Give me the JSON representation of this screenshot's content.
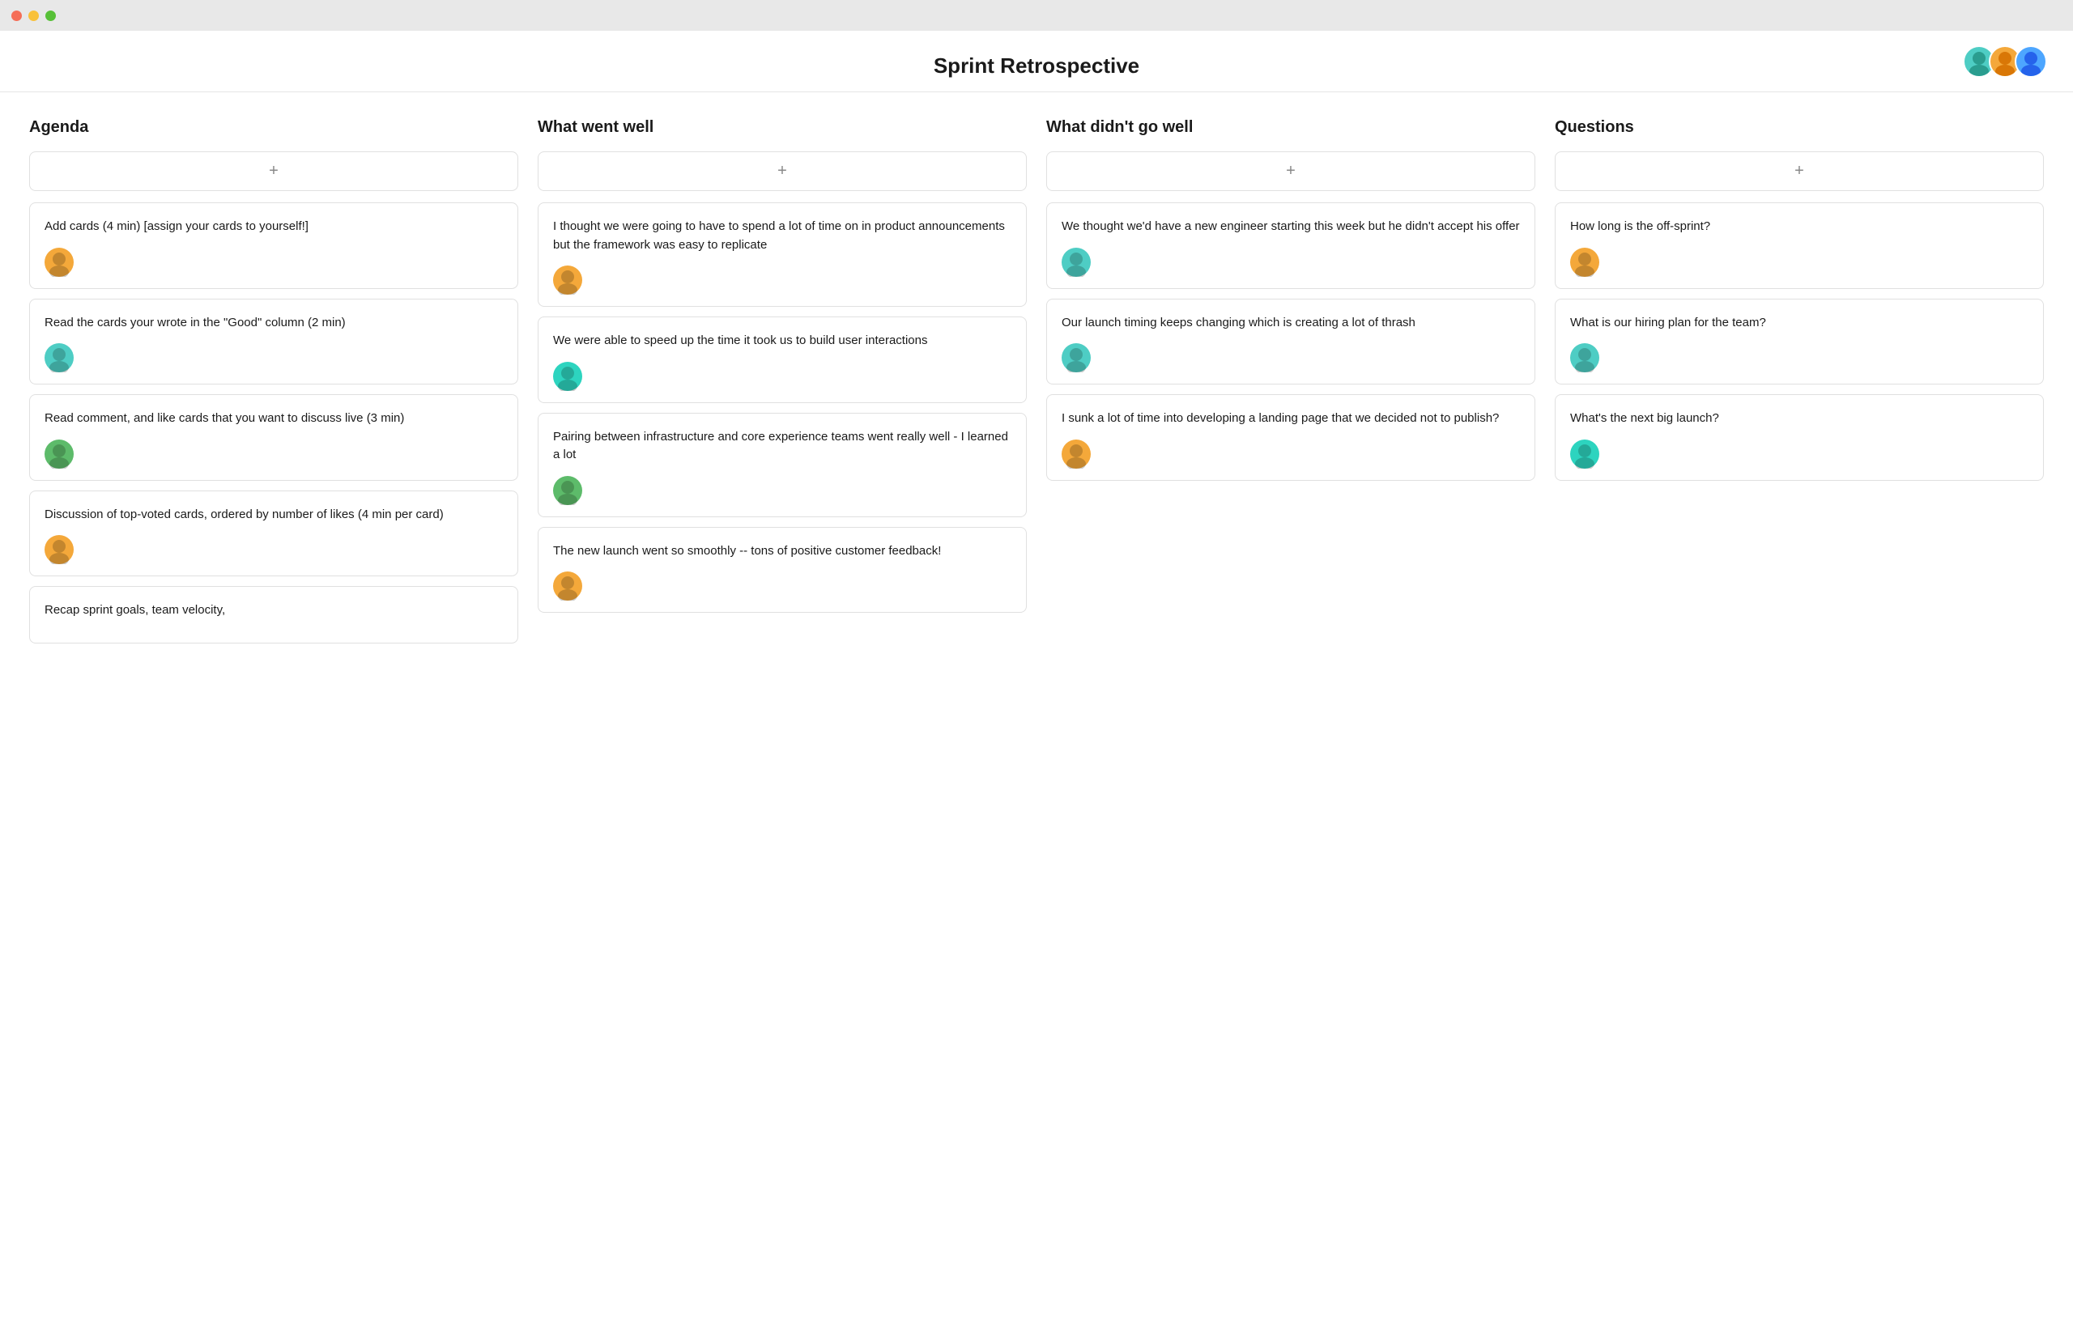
{
  "titleBar": {
    "dots": [
      "dot1",
      "dot2",
      "dot3"
    ]
  },
  "header": {
    "title": "Sprint Retrospective",
    "avatars": [
      {
        "color": "#4ecdc4",
        "label": "user1"
      },
      {
        "color": "#f4a83a",
        "label": "user2"
      },
      {
        "color": "#4da6ff",
        "label": "user3"
      }
    ]
  },
  "columns": [
    {
      "id": "agenda",
      "heading": "Agenda",
      "addLabel": "+",
      "cards": [
        {
          "text": "Add cards (4 min) [assign your cards to yourself!]",
          "avatarColor": "#f4a83a"
        },
        {
          "text": "Read the cards your wrote in the \"Good\" column (2 min)",
          "avatarColor": "#4ecdc4"
        },
        {
          "text": "Read comment, and like cards that you want to discuss live (3 min)",
          "avatarColor": "#5dbb6a"
        },
        {
          "text": "Discussion of top-voted cards, ordered by number of likes (4 min per card)",
          "avatarColor": "#f4a83a"
        },
        {
          "text": "Recap sprint goals, team velocity,",
          "avatarColor": null
        }
      ]
    },
    {
      "id": "what-went-well",
      "heading": "What went well",
      "addLabel": "+",
      "cards": [
        {
          "text": "I thought we were going to have to spend a lot of time on in product announcements but the framework was easy to replicate",
          "avatarColor": "#f4a83a"
        },
        {
          "text": "We were able to speed up the time it took us to build user interactions",
          "avatarColor": "#2dd4bf"
        },
        {
          "text": "Pairing between infrastructure and core experience teams went really well - I learned a lot",
          "avatarColor": "#5dbb6a"
        },
        {
          "text": "The new launch went so smoothly -- tons of positive customer feedback!",
          "avatarColor": "#f4a83a"
        }
      ]
    },
    {
      "id": "what-didnt-go-well",
      "heading": "What didn't go well",
      "addLabel": "+",
      "cards": [
        {
          "text": "We thought we'd have a new engineer starting this week but he didn't accept his offer",
          "avatarColor": "#4ecdc4"
        },
        {
          "text": "Our launch timing keeps changing which is creating a lot of thrash",
          "avatarColor": "#4ecdc4"
        },
        {
          "text": "I sunk a lot of time into developing a landing page that we decided not to publish?",
          "avatarColor": "#f4a83a"
        }
      ]
    },
    {
      "id": "questions",
      "heading": "Questions",
      "addLabel": "+",
      "cards": [
        {
          "text": "How long is the off-sprint?",
          "avatarColor": "#f4a83a"
        },
        {
          "text": "What is our hiring plan for the team?",
          "avatarColor": "#4ecdc4"
        },
        {
          "text": "What's the next big launch?",
          "avatarColor": "#2dd4bf"
        }
      ]
    }
  ]
}
